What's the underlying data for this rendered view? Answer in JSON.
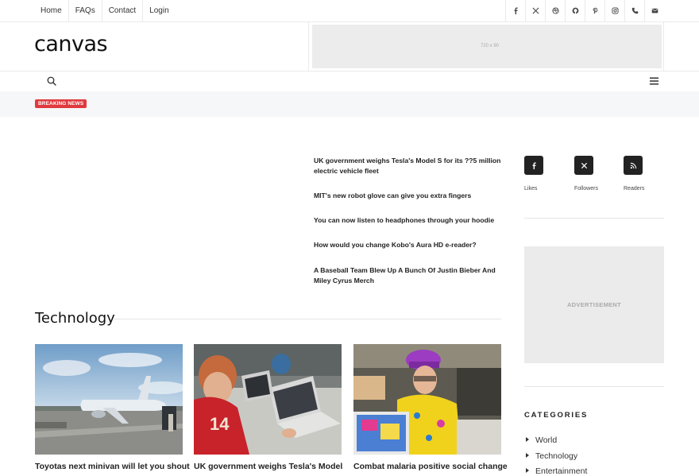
{
  "topnav": {
    "links": [
      "Home",
      "FAQs",
      "Contact",
      "Login"
    ]
  },
  "social_icons": [
    "facebook-icon",
    "x-icon",
    "dribbble-icon",
    "github-icon",
    "pinterest-icon",
    "instagram-icon",
    "phone-icon",
    "email-icon"
  ],
  "header": {
    "logo": "canvas",
    "ad_size": "720 x 90"
  },
  "breaking": {
    "badge": "BREAKING NEWS"
  },
  "headlines": [
    "UK government weighs Tesla's Model S for its ??5 million electric vehicle fleet",
    "MIT's new robot glove can give you extra fingers",
    "You can now listen to headphones through your hoodie",
    "How would you change Kobo's Aura HD e-reader?",
    "A Baseball Team Blew Up A Bunch Of Justin Bieber And Miley Cyrus Merch"
  ],
  "section": {
    "title": "Technology"
  },
  "cards": [
    "Toyotas next minivan will let you shout",
    "UK government weighs Tesla's Model",
    "Combat malaria positive social change"
  ],
  "counters": [
    {
      "label": "Likes",
      "icon": "facebook-icon"
    },
    {
      "label": "Followers",
      "icon": "x-icon"
    },
    {
      "label": "Readers",
      "icon": "rss-icon"
    }
  ],
  "sidebar": {
    "advertisement": "ADVERTISEMENT",
    "categories_title": "CATEGORIES",
    "categories": [
      "World",
      "Technology",
      "Entertainment"
    ]
  },
  "colors": {
    "badge": "#e03a3e",
    "dark_button": "#222222"
  }
}
